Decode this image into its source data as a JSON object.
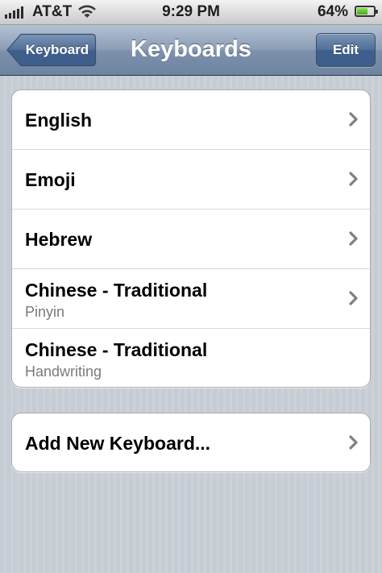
{
  "status_bar": {
    "carrier": "AT&T",
    "time": "9:29 PM",
    "battery_percent": "64%",
    "battery_level": 0.64,
    "signal_bars": 5,
    "icons": [
      "signal-bars-icon",
      "wifi-icon",
      "battery-icon"
    ]
  },
  "nav": {
    "title": "Keyboards",
    "back_label": "Keyboard",
    "edit_label": "Edit"
  },
  "keyboards": [
    {
      "title": "English",
      "subtitle": "",
      "disclosure": true
    },
    {
      "title": "Emoji",
      "subtitle": "",
      "disclosure": true
    },
    {
      "title": "Hebrew",
      "subtitle": "",
      "disclosure": true
    },
    {
      "title": "Chinese - Traditional",
      "subtitle": "Pinyin",
      "disclosure": true
    },
    {
      "title": "Chinese - Traditional",
      "subtitle": "Handwriting",
      "disclosure": false
    }
  ],
  "add_keyboard": {
    "label": "Add New Keyboard..."
  },
  "colors": {
    "nav_bar": "#6d83a1",
    "background": "#c5ccd4",
    "subtitle_text": "#7b7b7b",
    "chevron": "#7f7f7f"
  }
}
